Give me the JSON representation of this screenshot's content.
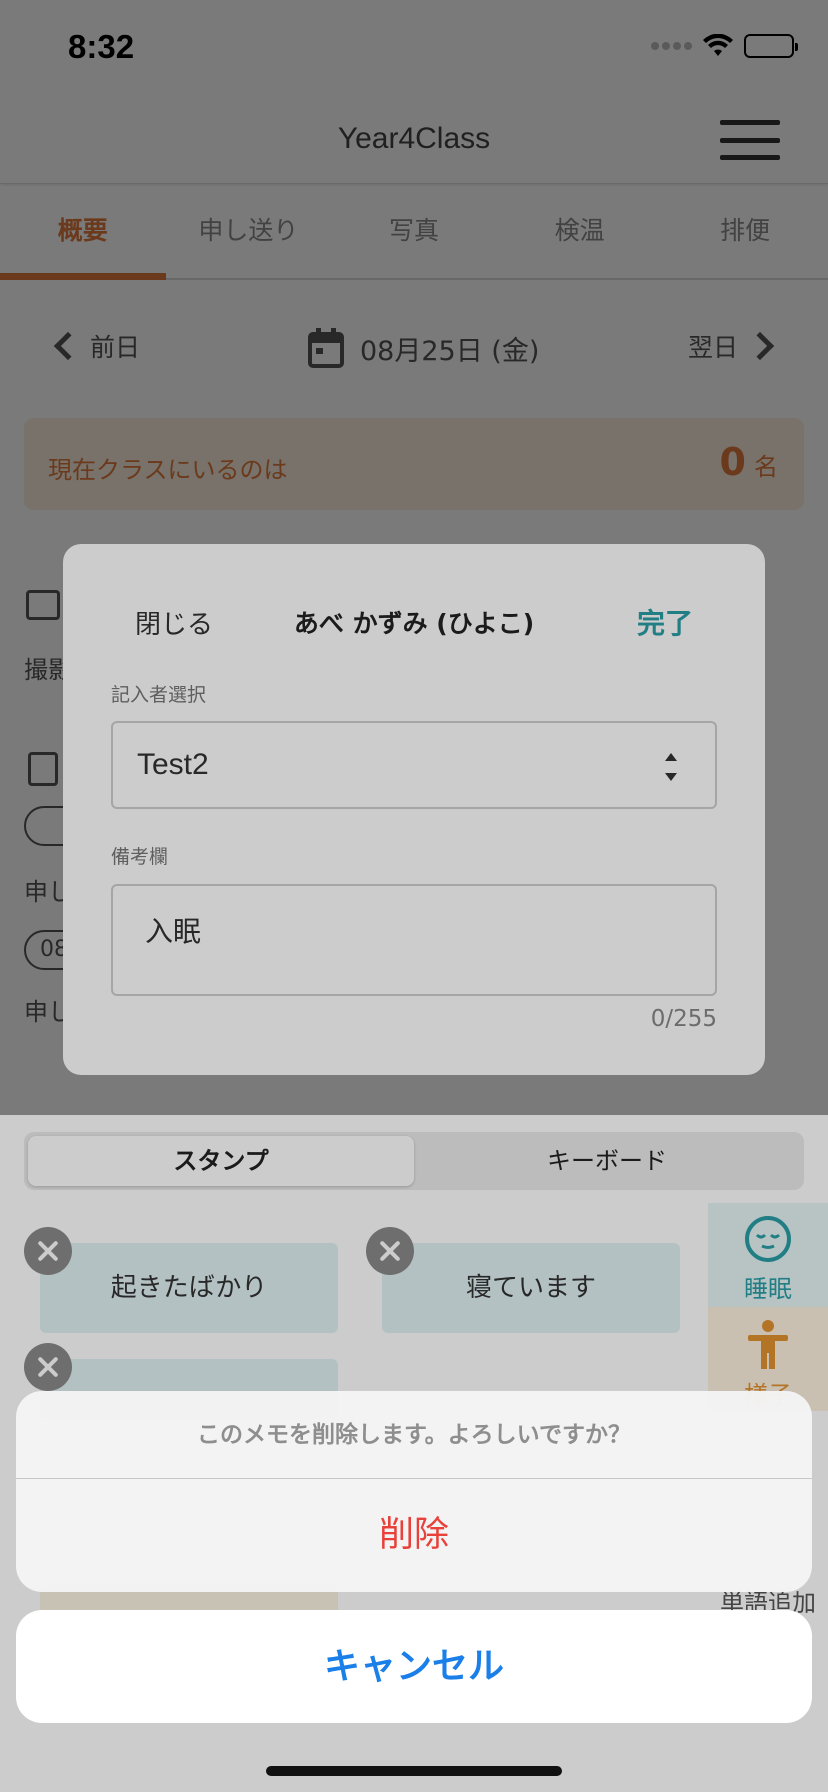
{
  "status_bar": {
    "time": "8:32"
  },
  "header": {
    "title": "Year4Class"
  },
  "tabs": [
    {
      "label": "概要"
    },
    {
      "label": "申し送り"
    },
    {
      "label": "写真"
    },
    {
      "label": "検温"
    },
    {
      "label": "排便"
    }
  ],
  "date_nav": {
    "prev": "前日",
    "date": "08月25日 (金)",
    "next": "翌日"
  },
  "presence": {
    "label": "現在クラスにいるのは",
    "count": "0",
    "unit": "名"
  },
  "background": {
    "photo_text": "撮影",
    "note_text_1": "申し",
    "pill_text": "08",
    "note_text_2": "申し"
  },
  "note_modal": {
    "close": "閉じる",
    "title": "あべ かずみ (ひよこ)",
    "done": "完了",
    "writer_label": "記入者選択",
    "writer_value": "Test2",
    "memo_label": "備考欄",
    "memo_value": "入眠",
    "char_count": "0/255"
  },
  "stamp_panel": {
    "tabs": [
      "スタンプ",
      "キーボード"
    ],
    "stamps": [
      "起きたばかり",
      "寝ています"
    ],
    "categories": [
      {
        "label": "睡眠",
        "icon": "sleep-face-icon",
        "color": "#2a9ea6"
      },
      {
        "label": "様子",
        "icon": "person-icon",
        "color": "#e0922f"
      }
    ],
    "add_phrase": "単語追加"
  },
  "action_sheet": {
    "message": "このメモを削除します。よろしいですか？",
    "delete": "削除",
    "cancel": "キャンセル"
  },
  "colors": {
    "accent_orange": "#e07b3c",
    "accent_teal": "#2a9ea6",
    "destructive": "#e8403a",
    "ios_blue": "#1a7fe8"
  }
}
